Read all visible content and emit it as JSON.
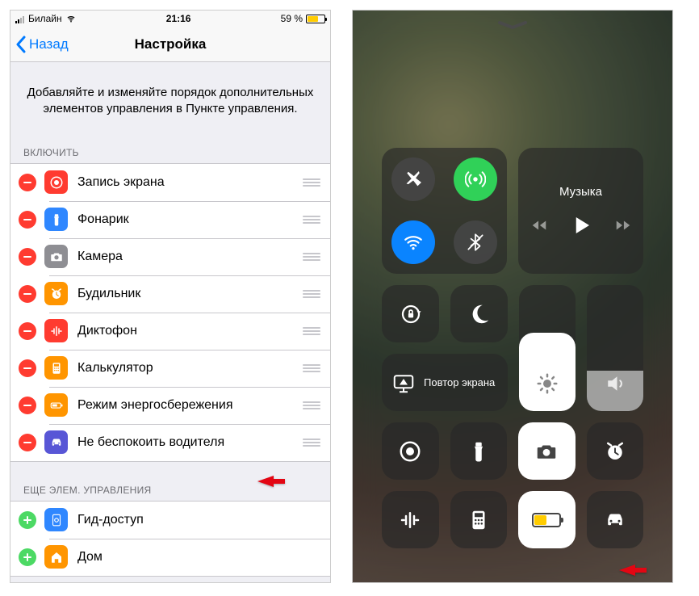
{
  "status": {
    "carrier": "Билайн",
    "time": "21:16",
    "battery_pct": "59 %"
  },
  "nav": {
    "back": "Назад",
    "title": "Настройка"
  },
  "instruction": "Добавляйте и изменяйте порядок дополнительных элементов управления в Пункте управления.",
  "sections": {
    "included": "ВКЛЮЧИТЬ",
    "more": "ЕЩЕ ЭЛЕМ. УПРАВЛЕНИЯ"
  },
  "included_items": [
    {
      "label": "Запись экрана",
      "icon": "record",
      "color": "#ff3b30"
    },
    {
      "label": "Фонарик",
      "icon": "flashlight",
      "color": "#2f87ff"
    },
    {
      "label": "Камера",
      "icon": "camera",
      "color": "#8e8e93"
    },
    {
      "label": "Будильник",
      "icon": "alarm",
      "color": "#ff9500"
    },
    {
      "label": "Диктофон",
      "icon": "waveform",
      "color": "#ff3b30"
    },
    {
      "label": "Калькулятор",
      "icon": "calculator",
      "color": "#ff9500"
    },
    {
      "label": "Режим энергосбережения",
      "icon": "battery",
      "color": "#ff9500"
    },
    {
      "label": "Не беспокоить водителя",
      "icon": "car",
      "color": "#5856d6"
    }
  ],
  "more_items": [
    {
      "label": "Гид-доступ",
      "icon": "guided",
      "color": "#2f87ff"
    },
    {
      "label": "Дом",
      "icon": "home",
      "color": "#ff9500"
    }
  ],
  "control_center": {
    "music_label": "Музыка",
    "mirror_label": "Повтор экрана"
  },
  "colors": {
    "ios_blue": "#007aff",
    "ios_red": "#ff3b30",
    "ios_green": "#4cd964",
    "ios_orange": "#ff9500",
    "ios_purple": "#5856d6",
    "annotation_red": "#e30613"
  }
}
